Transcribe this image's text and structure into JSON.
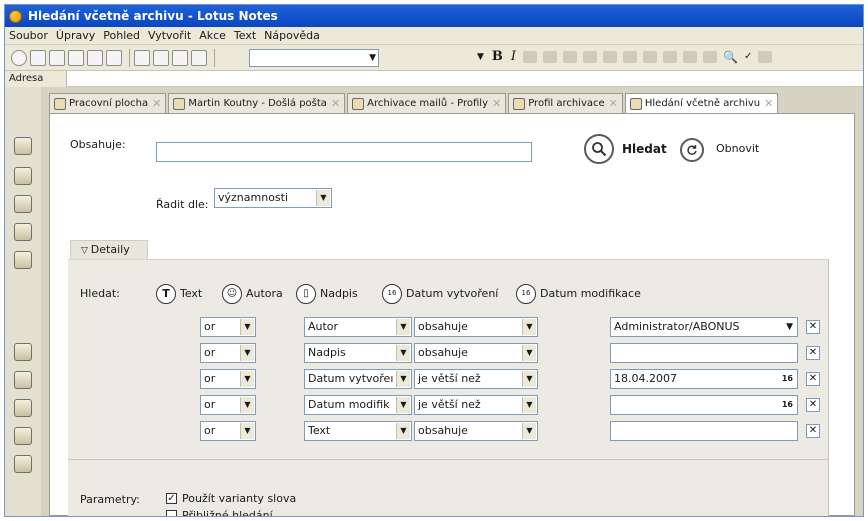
{
  "window": {
    "title": "Hledání včetně archivu - Lotus Notes"
  },
  "menu": [
    "Soubor",
    "Úpravy",
    "Pohled",
    "Vytvořit",
    "Akce",
    "Text",
    "Nápověda"
  ],
  "address": {
    "label": "Adresa"
  },
  "tabs": [
    {
      "label": "Pracovní plocha"
    },
    {
      "label": "Martin Koutny - Došlá pošta"
    },
    {
      "label": "Archivace mailů - Profily"
    },
    {
      "label": "Profil archivace"
    },
    {
      "label": "Hledání včetně archivu"
    }
  ],
  "search": {
    "contains_label": "Obsahuje:",
    "contains_value": "",
    "sort_label": "Řadit dle:",
    "sort_value": "významnosti",
    "search_button": "Hledat",
    "reset_button": "Obnovit"
  },
  "details": {
    "tab_label": "Detaily",
    "search_label": "Hledat:",
    "types": [
      "Text",
      "Autora",
      "Nadpis",
      "Datum vytvoření",
      "Datum modifikace"
    ],
    "rows": [
      {
        "op": "or",
        "field": "Autor",
        "cond": "obsahuje",
        "value": "Administrator/ABONUS"
      },
      {
        "op": "or",
        "field": "Nadpis",
        "cond": "obsahuje",
        "value": ""
      },
      {
        "op": "or",
        "field": "Datum vytvořeı",
        "cond": "je větší než",
        "value": "18.04.2007"
      },
      {
        "op": "or",
        "field": "Datum modifik",
        "cond": "je větší než",
        "value": ""
      },
      {
        "op": "or",
        "field": "Text",
        "cond": "obsahuje",
        "value": ""
      }
    ]
  },
  "params": {
    "label": "Parametry:",
    "opt1": "Použít varianty slova",
    "opt1_checked": true,
    "opt2": "Přibližné hledání",
    "opt2_checked": false
  }
}
